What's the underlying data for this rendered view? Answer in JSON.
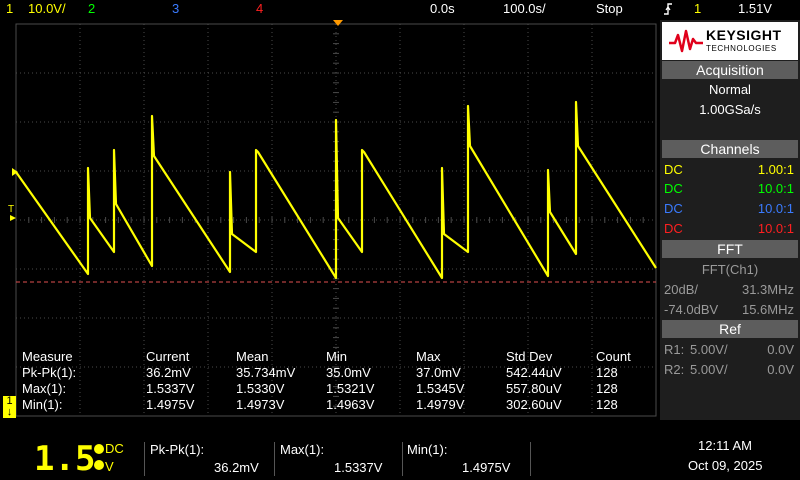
{
  "colors": {
    "ch1": "#ffff00",
    "ch2": "#00ff00",
    "ch3": "#3a7bff",
    "ch4": "#ff2020",
    "trigger": "#ff9a00",
    "grid": "#4a4a4a",
    "panel_header": "#5d5d5d"
  },
  "top_bar": {
    "ch1_scale": "10.0V/",
    "ch2": "2",
    "ch3": "3",
    "ch4": "4",
    "time_delay": "0.0s",
    "time_scale": "100.0s/",
    "run_state": "Stop",
    "trigger_icon": "trigger-edge-icon",
    "trigger_channel": "1",
    "trigger_level": "1.51V"
  },
  "graticule": {
    "ground_marker": "1",
    "trigger_marker": "T"
  },
  "measurements": {
    "headers": [
      "Measure",
      "Current",
      "Mean",
      "Min",
      "Max",
      "Std Dev",
      "Count"
    ],
    "rows": [
      [
        "Pk-Pk(1):",
        "36.2mV",
        "35.734mV",
        "35.0mV",
        "37.0mV",
        "542.44uV",
        "128"
      ],
      [
        "Max(1):",
        "1.5337V",
        "1.5330V",
        "1.5321V",
        "1.5345V",
        "557.80uV",
        "128"
      ],
      [
        "Min(1):",
        "1.4975V",
        "1.4973V",
        "1.4963V",
        "1.4979V",
        "302.60uV",
        "128"
      ]
    ]
  },
  "panel": {
    "brand_name": "KEYSIGHT",
    "brand_sub": "TECHNOLOGIES",
    "acquisition": {
      "title": "Acquisition",
      "mode": "Normal",
      "rate": "1.00GSa/s"
    },
    "channels": {
      "title": "Channels",
      "items": [
        {
          "coupling": "DC",
          "probe": "1.00:1",
          "color": "#ffff00"
        },
        {
          "coupling": "DC",
          "probe": "10.0:1",
          "color": "#00ff00"
        },
        {
          "coupling": "DC",
          "probe": "10.0:1",
          "color": "#3a7bff"
        },
        {
          "coupling": "DC",
          "probe": "10.0:1",
          "color": "#ff2020"
        }
      ]
    },
    "fft": {
      "title": "FFT",
      "source": "FFT(Ch1)",
      "scale": "20dB/",
      "center": "31.3MHz",
      "offset": "-74.0dBV",
      "span": "15.6MHz"
    },
    "ref": {
      "title": "Ref",
      "r1_label": "R1:",
      "r1_scale": "5.00V/",
      "r1_offset": "0.0V",
      "r2_label": "R2:",
      "r2_scale": "5.00V/",
      "r2_offset": "0.0V"
    }
  },
  "bottom_bar": {
    "digital_value": "1.5",
    "coupling": "DC",
    "unit": "V",
    "m1_label": "Pk-Pk(1):",
    "m1_value": "36.2mV",
    "m2_label": "Max(1):",
    "m2_value": "1.5337V",
    "m3_label": "Min(1):",
    "m3_value": "1.4975V",
    "time": "12:11 AM",
    "date": "Oct 09, 2025"
  }
}
